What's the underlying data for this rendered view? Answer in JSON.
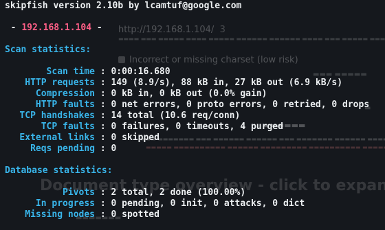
{
  "terminal": {
    "banner": "skipfish version 2.10b by lcamtuf@google.com",
    "target": {
      "prefix": "  - ",
      "ip": "192.168.1.104",
      "suffix": " -"
    },
    "scan_section": "Scan statistics:",
    "scan_stats": [
      {
        "label": "Scan time",
        "value": "0:00:16.680"
      },
      {
        "label": "HTTP requests",
        "value": "149 (8.9/s), 88 kB in, 27 kB out (6.9 kB/s)"
      },
      {
        "label": "Compression",
        "value": "0 kB in, 0 kB out (0.0% gain)"
      },
      {
        "label": "HTTP faults",
        "value": "0 net errors, 0 proto errors, 0 retried, 0 drops"
      },
      {
        "label": "TCP handshakes",
        "value": "14 total (10.6 req/conn)"
      },
      {
        "label": "TCP faults",
        "value": "0 failures, 0 timeouts, 4 purged"
      },
      {
        "label": "External links",
        "value": "0 skipped"
      },
      {
        "label": "Reqs pending",
        "value": "0"
      }
    ],
    "db_section": "Database statistics:",
    "db_stats": [
      {
        "label": "Pivots",
        "value": "2 total, 2 done (100.00%)"
      },
      {
        "label": "In progress",
        "value": "0 pending, 0 init, 0 attacks, 0 dict"
      },
      {
        "label": "Missing nodes",
        "value": "0 spotted"
      }
    ]
  },
  "background_report": {
    "url": "http://192.168.1.104/",
    "count": "3",
    "issue_title": "Incorrect or missing charset (low risk)",
    "doc_heading": "Document type overview - click to expand:"
  },
  "colors": {
    "background": "#15181d",
    "text": "#eceff1",
    "label": "#39b5ea",
    "ip": "#ff5f87"
  }
}
